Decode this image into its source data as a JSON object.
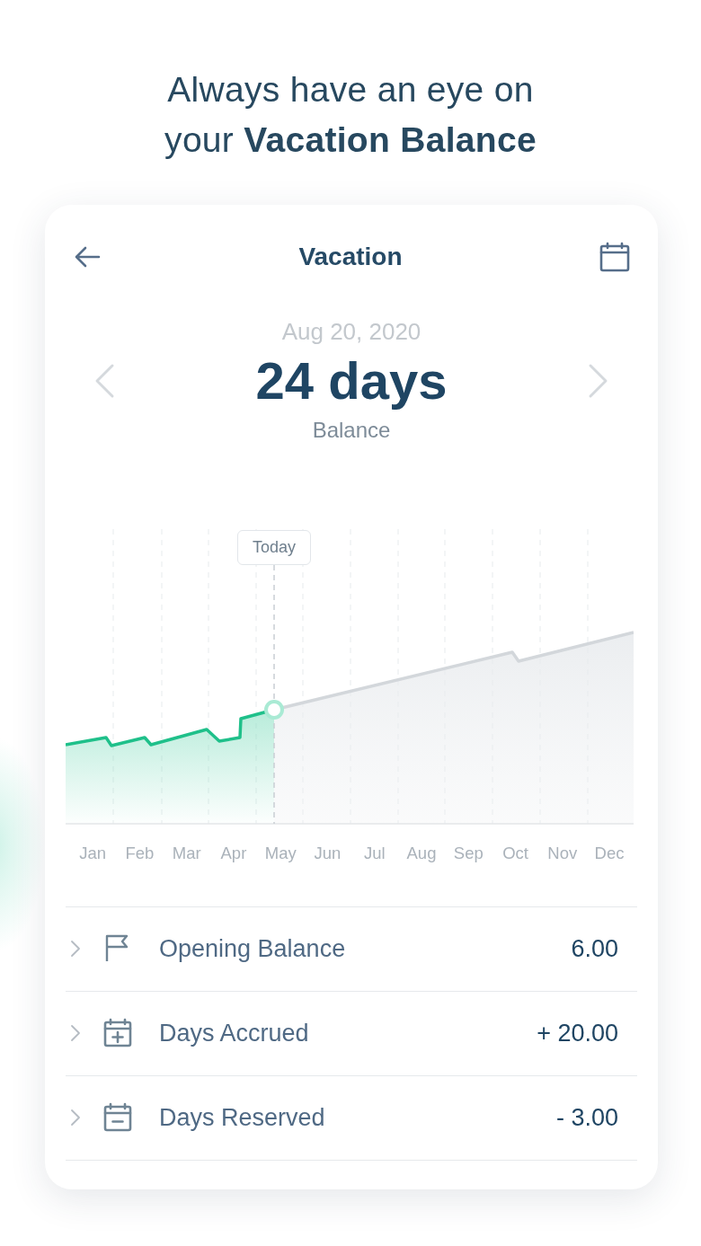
{
  "headline": {
    "lines": [
      "Always have an eye on",
      "your **Vacation Balance**"
    ]
  },
  "header": {
    "title": "Vacation"
  },
  "summary": {
    "date": "Aug 20, 2020",
    "amount": "24 days",
    "caption": "Balance"
  },
  "chart": {
    "today_label": "Today",
    "months": [
      "Jan",
      "Feb",
      "Mar",
      "Apr",
      "May",
      "Jun",
      "Jul",
      "Aug",
      "Sep",
      "Oct",
      "Nov",
      "Dec"
    ]
  },
  "rows": [
    {
      "kind": "opening",
      "label": "Opening Balance",
      "value": "6.00"
    },
    {
      "kind": "accrual",
      "label": "Days Accrued",
      "value": "+ 20.00"
    },
    {
      "kind": "reservation",
      "label": "Days Reserved",
      "value": "- 3.00"
    }
  ]
}
